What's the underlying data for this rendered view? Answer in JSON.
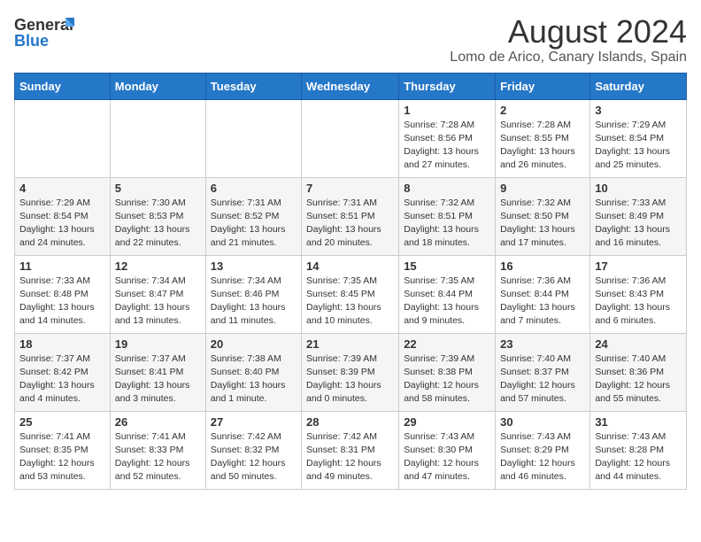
{
  "logo": {
    "general": "General",
    "blue": "Blue"
  },
  "header": {
    "title": "August 2024",
    "subtitle": "Lomo de Arico, Canary Islands, Spain"
  },
  "weekdays": [
    "Sunday",
    "Monday",
    "Tuesday",
    "Wednesday",
    "Thursday",
    "Friday",
    "Saturday"
  ],
  "weeks": [
    [
      {
        "day": "",
        "info": ""
      },
      {
        "day": "",
        "info": ""
      },
      {
        "day": "",
        "info": ""
      },
      {
        "day": "",
        "info": ""
      },
      {
        "day": "1",
        "info": "Sunrise: 7:28 AM\nSunset: 8:56 PM\nDaylight: 13 hours\nand 27 minutes."
      },
      {
        "day": "2",
        "info": "Sunrise: 7:28 AM\nSunset: 8:55 PM\nDaylight: 13 hours\nand 26 minutes."
      },
      {
        "day": "3",
        "info": "Sunrise: 7:29 AM\nSunset: 8:54 PM\nDaylight: 13 hours\nand 25 minutes."
      }
    ],
    [
      {
        "day": "4",
        "info": "Sunrise: 7:29 AM\nSunset: 8:54 PM\nDaylight: 13 hours\nand 24 minutes."
      },
      {
        "day": "5",
        "info": "Sunrise: 7:30 AM\nSunset: 8:53 PM\nDaylight: 13 hours\nand 22 minutes."
      },
      {
        "day": "6",
        "info": "Sunrise: 7:31 AM\nSunset: 8:52 PM\nDaylight: 13 hours\nand 21 minutes."
      },
      {
        "day": "7",
        "info": "Sunrise: 7:31 AM\nSunset: 8:51 PM\nDaylight: 13 hours\nand 20 minutes."
      },
      {
        "day": "8",
        "info": "Sunrise: 7:32 AM\nSunset: 8:51 PM\nDaylight: 13 hours\nand 18 minutes."
      },
      {
        "day": "9",
        "info": "Sunrise: 7:32 AM\nSunset: 8:50 PM\nDaylight: 13 hours\nand 17 minutes."
      },
      {
        "day": "10",
        "info": "Sunrise: 7:33 AM\nSunset: 8:49 PM\nDaylight: 13 hours\nand 16 minutes."
      }
    ],
    [
      {
        "day": "11",
        "info": "Sunrise: 7:33 AM\nSunset: 8:48 PM\nDaylight: 13 hours\nand 14 minutes."
      },
      {
        "day": "12",
        "info": "Sunrise: 7:34 AM\nSunset: 8:47 PM\nDaylight: 13 hours\nand 13 minutes."
      },
      {
        "day": "13",
        "info": "Sunrise: 7:34 AM\nSunset: 8:46 PM\nDaylight: 13 hours\nand 11 minutes."
      },
      {
        "day": "14",
        "info": "Sunrise: 7:35 AM\nSunset: 8:45 PM\nDaylight: 13 hours\nand 10 minutes."
      },
      {
        "day": "15",
        "info": "Sunrise: 7:35 AM\nSunset: 8:44 PM\nDaylight: 13 hours\nand 9 minutes."
      },
      {
        "day": "16",
        "info": "Sunrise: 7:36 AM\nSunset: 8:44 PM\nDaylight: 13 hours\nand 7 minutes."
      },
      {
        "day": "17",
        "info": "Sunrise: 7:36 AM\nSunset: 8:43 PM\nDaylight: 13 hours\nand 6 minutes."
      }
    ],
    [
      {
        "day": "18",
        "info": "Sunrise: 7:37 AM\nSunset: 8:42 PM\nDaylight: 13 hours\nand 4 minutes."
      },
      {
        "day": "19",
        "info": "Sunrise: 7:37 AM\nSunset: 8:41 PM\nDaylight: 13 hours\nand 3 minutes."
      },
      {
        "day": "20",
        "info": "Sunrise: 7:38 AM\nSunset: 8:40 PM\nDaylight: 13 hours\nand 1 minute."
      },
      {
        "day": "21",
        "info": "Sunrise: 7:39 AM\nSunset: 8:39 PM\nDaylight: 13 hours\nand 0 minutes."
      },
      {
        "day": "22",
        "info": "Sunrise: 7:39 AM\nSunset: 8:38 PM\nDaylight: 12 hours\nand 58 minutes."
      },
      {
        "day": "23",
        "info": "Sunrise: 7:40 AM\nSunset: 8:37 PM\nDaylight: 12 hours\nand 57 minutes."
      },
      {
        "day": "24",
        "info": "Sunrise: 7:40 AM\nSunset: 8:36 PM\nDaylight: 12 hours\nand 55 minutes."
      }
    ],
    [
      {
        "day": "25",
        "info": "Sunrise: 7:41 AM\nSunset: 8:35 PM\nDaylight: 12 hours\nand 53 minutes."
      },
      {
        "day": "26",
        "info": "Sunrise: 7:41 AM\nSunset: 8:33 PM\nDaylight: 12 hours\nand 52 minutes."
      },
      {
        "day": "27",
        "info": "Sunrise: 7:42 AM\nSunset: 8:32 PM\nDaylight: 12 hours\nand 50 minutes."
      },
      {
        "day": "28",
        "info": "Sunrise: 7:42 AM\nSunset: 8:31 PM\nDaylight: 12 hours\nand 49 minutes."
      },
      {
        "day": "29",
        "info": "Sunrise: 7:43 AM\nSunset: 8:30 PM\nDaylight: 12 hours\nand 47 minutes."
      },
      {
        "day": "30",
        "info": "Sunrise: 7:43 AM\nSunset: 8:29 PM\nDaylight: 12 hours\nand 46 minutes."
      },
      {
        "day": "31",
        "info": "Sunrise: 7:43 AM\nSunset: 8:28 PM\nDaylight: 12 hours\nand 44 minutes."
      }
    ]
  ]
}
